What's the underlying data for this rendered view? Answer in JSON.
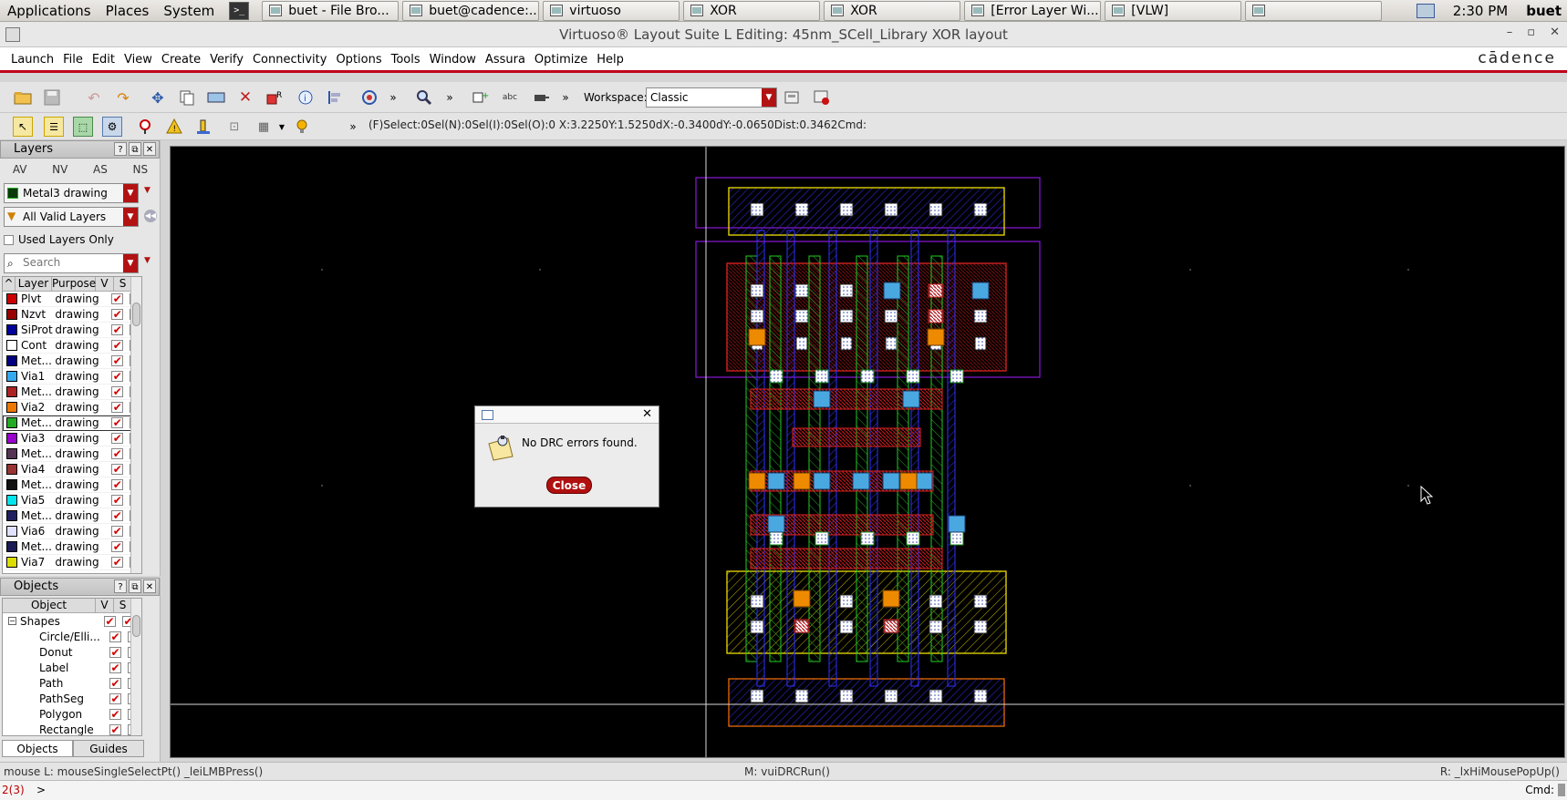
{
  "taskbar": {
    "menus": [
      "Applications",
      "Places",
      "System"
    ],
    "tasks": [
      {
        "label": "buet - File Bro...",
        "icon": "folder-icon"
      },
      {
        "label": "buet@cadence:...",
        "icon": "terminal-icon"
      },
      {
        "label": "virtuoso",
        "icon": "virtuoso-icon"
      },
      {
        "label": "XOR",
        "icon": "cadence-window-icon"
      },
      {
        "label": "XOR",
        "icon": "cadence-window-icon"
      },
      {
        "label": "[Error Layer Wi...",
        "icon": "cadence-window-icon"
      },
      {
        "label": "[VLW]",
        "icon": "cadence-window-icon"
      },
      {
        "label": "",
        "icon": "window-icon"
      }
    ],
    "clock": "2:30 PM",
    "user": "buet"
  },
  "window": {
    "title": "Virtuoso® Layout Suite L Editing: 45nm_SCell_Library XOR layout",
    "brand": "cādence"
  },
  "menubar": [
    "Launch",
    "File",
    "Edit",
    "View",
    "Create",
    "Verify",
    "Connectivity",
    "Options",
    "Tools",
    "Window",
    "Assura",
    "Optimize",
    "Help"
  ],
  "toolbar": {
    "workspace_label": "Workspace:",
    "workspace_value": "Classic",
    "status": "(F)Select:0Sel(N):0Sel(I):0Sel(O):0   X:3.2250Y:1.5250dX:-0.3400dY:-0.0650Dist:0.3462Cmd:"
  },
  "layers_panel": {
    "title": "Layers",
    "tabs": [
      "AV",
      "NV",
      "AS",
      "NS"
    ],
    "current_layer": "Metal3 drawing",
    "filter": "All Valid Layers",
    "used_only_label": "Used Layers Only",
    "search_placeholder": "Search",
    "columns": [
      "Layer",
      "Purpose",
      "V",
      "S"
    ],
    "rows": [
      {
        "name": "Plvt",
        "purpose": "drawing",
        "color": "#cc0000"
      },
      {
        "name": "Nzvt",
        "purpose": "drawing",
        "color": "#990000"
      },
      {
        "name": "SiProt",
        "purpose": "drawing",
        "color": "#000099"
      },
      {
        "name": "Cont",
        "purpose": "drawing",
        "color": "#ffffff"
      },
      {
        "name": "Met...",
        "purpose": "drawing",
        "color": "#000080"
      },
      {
        "name": "Via1",
        "purpose": "drawing",
        "color": "#33aaee"
      },
      {
        "name": "Met...",
        "purpose": "drawing",
        "color": "#aa2222"
      },
      {
        "name": "Via2",
        "purpose": "drawing",
        "color": "#ee7700"
      },
      {
        "name": "Met...",
        "purpose": "drawing",
        "color": "#22aa22"
      },
      {
        "name": "Via3",
        "purpose": "drawing",
        "color": "#9900cc"
      },
      {
        "name": "Met...",
        "purpose": "drawing",
        "color": "#553355"
      },
      {
        "name": "Via4",
        "purpose": "drawing",
        "color": "#993333"
      },
      {
        "name": "Met...",
        "purpose": "drawing",
        "color": "#111111"
      },
      {
        "name": "Via5",
        "purpose": "drawing",
        "color": "#00e5ee"
      },
      {
        "name": "Met...",
        "purpose": "drawing",
        "color": "#202060"
      },
      {
        "name": "Via6",
        "purpose": "drawing",
        "color": "#e0e0ff"
      },
      {
        "name": "Met...",
        "purpose": "drawing",
        "color": "#1a1a55"
      },
      {
        "name": "Via7",
        "purpose": "drawing",
        "color": "#dddd00"
      }
    ]
  },
  "objects_panel": {
    "title": "Objects",
    "columns": [
      "Object",
      "V",
      "S"
    ],
    "root": "Shapes",
    "items": [
      "Circle/Elli...",
      "Donut",
      "Label",
      "Path",
      "PathSeg",
      "Polygon",
      "Rectangle"
    ],
    "tabs": [
      "Objects",
      "Guides"
    ]
  },
  "dialog": {
    "message": "No DRC errors found.",
    "close_label": "Close"
  },
  "status_bar": {
    "left": "mouse L: mouseSingleSelectPt() _leiLMBPress()",
    "middle": "M: vuiDRCRun()",
    "right": "R: _lxHiMousePopUp()"
  },
  "command_line": {
    "counter": "2(3)",
    "prompt": ">",
    "cmd_label": "Cmd:"
  }
}
